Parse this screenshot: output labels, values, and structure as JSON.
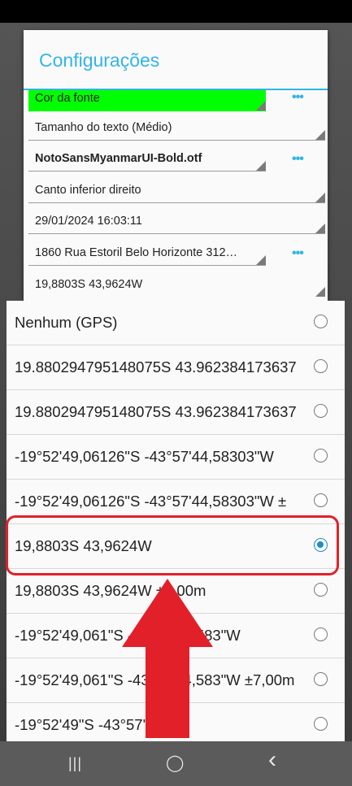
{
  "settings": {
    "title": "Configurações",
    "rows": [
      {
        "label": "Cor da fonte",
        "has_more": true
      },
      {
        "label": "Tamanho do texto (Médio)",
        "has_more": false
      },
      {
        "label": "NotoSansMyanmarUI-Bold.otf",
        "has_more": true
      },
      {
        "label": "Canto inferior direito",
        "has_more": false
      },
      {
        "label": "29/01/2024 16:03:11",
        "has_more": false
      },
      {
        "label": "1860 Rua Estoril Belo Horizonte 312…",
        "has_more": true
      },
      {
        "label": "19,8803S 43,9624W",
        "has_more": false
      }
    ],
    "more_glyph": "•••"
  },
  "picker": {
    "options": [
      {
        "label": "Nenhum (GPS)",
        "selected": false
      },
      {
        "label": "19.880294795148075S 43.962384173637",
        "selected": false
      },
      {
        "label": "19.880294795148075S 43.962384173637",
        "selected": false
      },
      {
        "label": "-19°52'49,06126\"S -43°57'44,58303\"W",
        "selected": false
      },
      {
        "label": "-19°52'49,06126\"S -43°57'44,58303\"W ±",
        "selected": false
      },
      {
        "label": "19,8803S 43,9624W",
        "selected": true
      },
      {
        "label": "19,8803S 43,9624W ±7,00m",
        "selected": false
      },
      {
        "label": "-19°52'49,061\"S -43°57'44,583\"W",
        "selected": false
      },
      {
        "label": "-19°52'49,061\"S -43°57'44,583\"W ±7,00m",
        "selected": false
      },
      {
        "label": "-19°52'49\"S -43°57'45\"W",
        "selected": false
      }
    ]
  },
  "nav": {
    "recent": "|||",
    "home": "◯",
    "back": "‹"
  },
  "colors": {
    "accent": "#33b5e5",
    "highlight": "#e2202a",
    "arrow": "#e2202a",
    "font_color_swatch": "#00ff00"
  }
}
